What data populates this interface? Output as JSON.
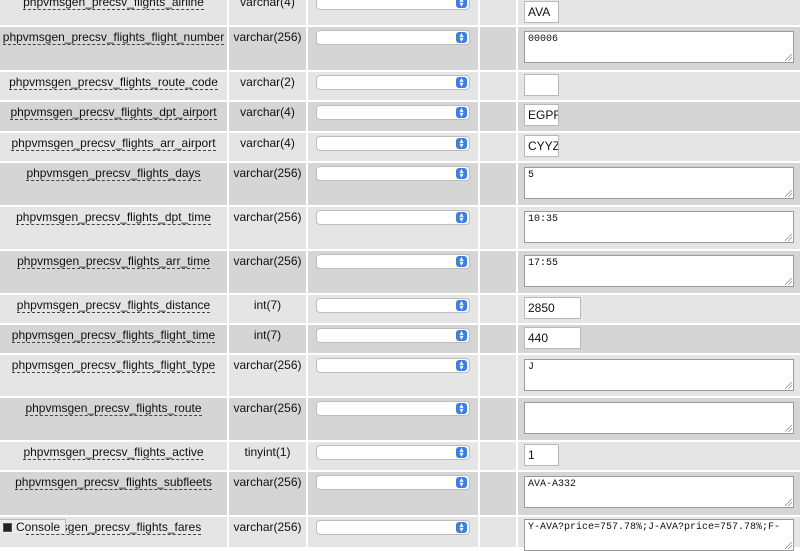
{
  "rows": [
    {
      "name": "phpvmsgen_precsv_flights_airline",
      "type": "varchar(4)",
      "value": "AVA",
      "kind": "input",
      "width": 35
    },
    {
      "name": "phpvmsgen_precsv_flights_flight_number",
      "type": "varchar(256)",
      "value": "00006",
      "kind": "textarea"
    },
    {
      "name": "phpvmsgen_precsv_flights_route_code",
      "type": "varchar(2)",
      "value": "",
      "kind": "input",
      "width": 35
    },
    {
      "name": "phpvmsgen_precsv_flights_dpt_airport",
      "type": "varchar(4)",
      "value": "EGPF",
      "kind": "input",
      "width": 35
    },
    {
      "name": "phpvmsgen_precsv_flights_arr_airport",
      "type": "varchar(4)",
      "value": "CYYZ",
      "kind": "input",
      "width": 35
    },
    {
      "name": "phpvmsgen_precsv_flights_days",
      "type": "varchar(256)",
      "value": "5",
      "kind": "textarea"
    },
    {
      "name": "phpvmsgen_precsv_flights_dpt_time",
      "type": "varchar(256)",
      "value": "10:35",
      "kind": "textarea"
    },
    {
      "name": "phpvmsgen_precsv_flights_arr_time",
      "type": "varchar(256)",
      "value": "17:55",
      "kind": "textarea"
    },
    {
      "name": "phpvmsgen_precsv_flights_distance",
      "type": "int(7)",
      "value": "2850",
      "kind": "input",
      "width": 57
    },
    {
      "name": "phpvmsgen_precsv_flights_flight_time",
      "type": "int(7)",
      "value": "440",
      "kind": "input",
      "width": 57
    },
    {
      "name": "phpvmsgen_precsv_flights_flight_type",
      "type": "varchar(256)",
      "value": "J",
      "kind": "textarea"
    },
    {
      "name": "phpvmsgen_precsv_flights_route",
      "type": "varchar(256)",
      "value": "",
      "kind": "textarea"
    },
    {
      "name": "phpvmsgen_precsv_flights_active",
      "type": "tinyint(1)",
      "value": "1",
      "kind": "input",
      "width": 35
    },
    {
      "name": "phpvmsgen_precsv_flights_subfleets",
      "type": "varchar(256)",
      "value": "AVA-A332",
      "kind": "textarea"
    },
    {
      "name": "phpvmsgen_precsv_flights_fares",
      "type": "varchar(256)",
      "value": "Y-AVA?price=757.78%;J-AVA?price=757.78%;F-",
      "kind": "textarea"
    }
  ],
  "console": {
    "label": "Console"
  }
}
